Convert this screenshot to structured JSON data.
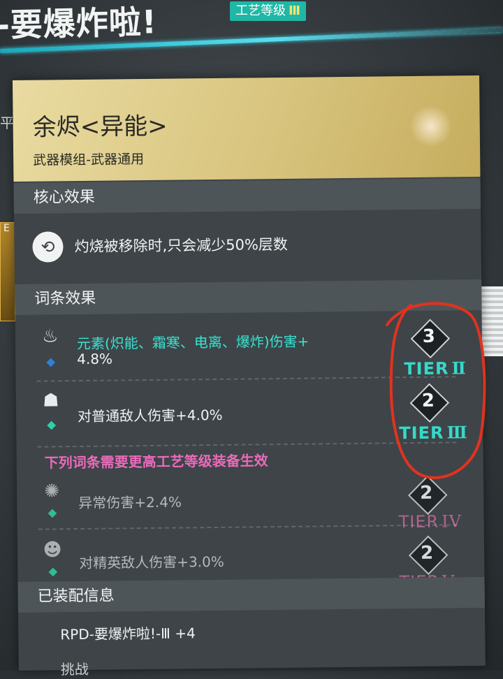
{
  "header": {
    "title": "-要爆炸啦!",
    "craft_level_label": "工艺等级",
    "craft_level_roman": "Ⅲ"
  },
  "edge": {
    "left_text": "平",
    "left_tile_letter": "E"
  },
  "mod": {
    "name": "余烬<异能>",
    "subtitle": "武器模组-武器通用"
  },
  "sections": {
    "core": "核心效果",
    "affix": "词条效果",
    "equipped": "已装配信息"
  },
  "core_effect": {
    "text": "灼烧被移除时,只会减少50%层数",
    "icon": "burn-removal-icon"
  },
  "affixes": [
    {
      "line1": "元素(炽能、霜寒、电离、爆炸)伤害+",
      "line2": "4.8%",
      "rank": "3",
      "tier": "TIER",
      "tier_roman": "Ⅱ",
      "gem_color": "#2f7fd8",
      "text_color": "#39e3d2",
      "icon": "element-icon"
    },
    {
      "line1": "对普通敌人伤害+4.0%",
      "rank": "2",
      "tier": "TIER",
      "tier_roman": "Ⅲ",
      "gem_color": "#2fd0a8",
      "text_color": "#f1f3f3",
      "icon": "enemy-icon"
    }
  ],
  "locked_note": "下列词条需要更高工艺等级装备生效",
  "locked_affixes": [
    {
      "text": "异常伤害+2.4%",
      "rank": "2",
      "tier": "TIER",
      "tier_roman": "IV",
      "gem_color": "#2fd0a8",
      "icon": "anomaly-icon"
    },
    {
      "text": "对精英敌人伤害+3.0%",
      "rank": "2",
      "tier": "TIER",
      "tier_roman": "V",
      "gem_color": "#2fd0a8",
      "icon": "elite-icon"
    }
  ],
  "equipped_info": {
    "line": "RPD-要爆炸啦!-Ⅲ +4",
    "line2": "挑战"
  },
  "colors": {
    "tier_active": "#36d9c8",
    "tier_locked": "#c06a9a",
    "annotation": "#e0331f",
    "hero_gold": "#d8c47e"
  }
}
